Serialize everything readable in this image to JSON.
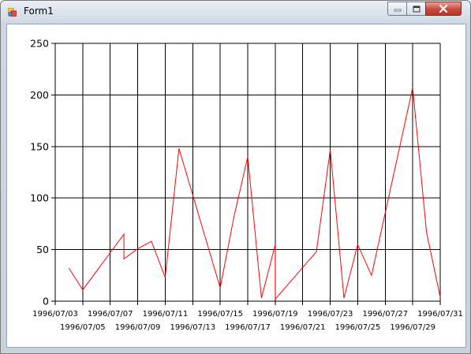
{
  "window": {
    "title": "Form1",
    "icon": "form-app-icon",
    "buttons": [
      "minimize-icon",
      "maximize-icon",
      "close-icon"
    ]
  },
  "chart_data": {
    "type": "line",
    "title": "",
    "xlabel": "",
    "ylabel": "",
    "ylim": [
      0,
      250
    ],
    "yticks": [
      0,
      50,
      100,
      150,
      200,
      250
    ],
    "xlim": [
      "1996/07/03",
      "1996/07/31"
    ],
    "xticks_top_row": [
      "1996/07/03",
      "1996/07/07",
      "1996/07/11",
      "1996/07/15",
      "1996/07/19",
      "1996/07/23",
      "1996/07/27",
      "1996/07/31"
    ],
    "xticks_bottom_row": [
      "1996/07/05",
      "1996/07/09",
      "1996/07/13",
      "1996/07/17",
      "1996/07/21",
      "1996/07/25",
      "1996/07/29"
    ],
    "grid": true,
    "series_color": "#ff0000",
    "series": [
      {
        "points": [
          {
            "x": "1996/07/04",
            "y": 32
          },
          {
            "x": "1996/07/05",
            "y": 11
          },
          {
            "x": "1996/07/08",
            "y": 65
          },
          {
            "x": "1996/07/08",
            "y": 41
          },
          {
            "x": "1996/07/09",
            "y": 51
          },
          {
            "x": "1996/07/10",
            "y": 58
          },
          {
            "x": "1996/07/11",
            "y": 23
          },
          {
            "x": "1996/07/12",
            "y": 148
          },
          {
            "x": "1996/07/15",
            "y": 13
          },
          {
            "x": "1996/07/16",
            "y": 82
          },
          {
            "x": "1996/07/17",
            "y": 140
          },
          {
            "x": "1996/07/18",
            "y": 3
          },
          {
            "x": "1996/07/19",
            "y": 55
          },
          {
            "x": "1996/07/19",
            "y": 2
          },
          {
            "x": "1996/07/22",
            "y": 48
          },
          {
            "x": "1996/07/23",
            "y": 147
          },
          {
            "x": "1996/07/24",
            "y": 3
          },
          {
            "x": "1996/07/25",
            "y": 55
          },
          {
            "x": "1996/07/26",
            "y": 25
          },
          {
            "x": "1996/07/29",
            "y": 207
          },
          {
            "x": "1996/07/30",
            "y": 67
          },
          {
            "x": "1996/07/31",
            "y": 4
          }
        ]
      }
    ]
  }
}
